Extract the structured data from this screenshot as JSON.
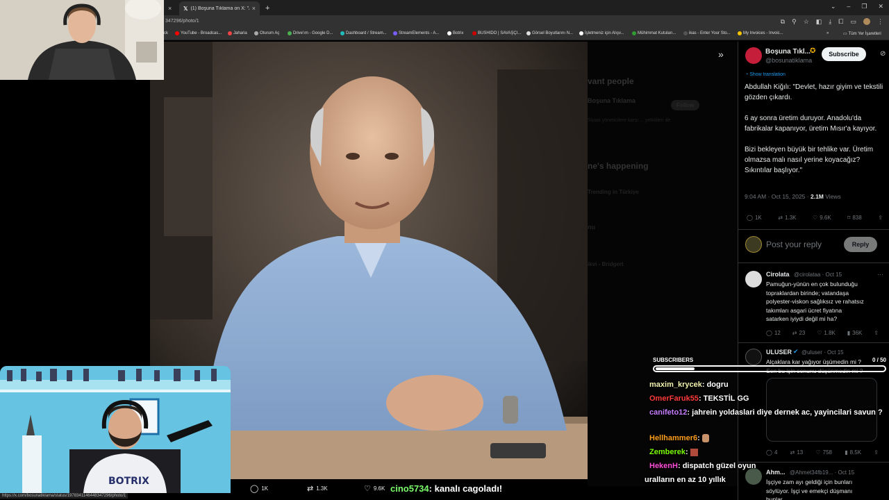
{
  "browser": {
    "tabs": [
      {
        "title": "",
        "close": "×"
      },
      {
        "title": "(1) Boşuna Tıklama on X: \"Abdu",
        "close": "×",
        "active": true
      }
    ],
    "new_tab": "+",
    "url": "347296/photo/1",
    "bookmarks": [
      "ck",
      "YouTube - Broadcas...",
      "Jaharia",
      "Oturum Aç",
      "Drive'ım - Google D...",
      "Dashboard / Stream...",
      "StreamElements - A...",
      "Botrix",
      "BUSHIDO | SAVAŞÇI...",
      "Görsel Boyutlarını N...",
      "İşletmeniz için Alışv...",
      "Mühimmat Kutuları...",
      "ikas - Enter Your Sto...",
      "My Invoices - Invoic..."
    ],
    "bookmarks_more": "»",
    "all_bookmarks": "Tüm Yer İşaretleri",
    "status_url": "https://x.com/bosunatiklama/status/1978341146448347296/photo/1"
  },
  "dim_panel": {
    "items": [
      "vant people",
      "Boşuna Tıklama",
      "Follow",
      "Siyasi yöneticilere karşı ... yetkilileri de",
      "ne's happening",
      "Trending in Türkiye",
      "nu",
      "ikvi - Bridgert"
    ]
  },
  "tweet": {
    "author_name": "Boşuna Tıkl...",
    "author_handle": "@bosunatiklama",
    "subscribe_label": "Subscribe",
    "show_translation": "Show translation",
    "body": "Abdullah Kiğılı: \"Devlet, hazır giyim ve tekstili gözden çıkardı.\n\n6 ay sonra üretim duruyor. Anadolu'da fabrikalar kapanıyor, üretim Mısır'a kayıyor.\n\nBizi bekleyen büyük bir tehlike var. Üretim olmazsa malı nasıl yerine koyacağız? Sıkıntılar başlıyor.\"",
    "time": "9:04 AM · Oct 15, 2025 ·",
    "views": "2.1M",
    "views_label": "Views",
    "stats": {
      "replies": "1K",
      "retweets": "1.3K",
      "likes": "9.6K",
      "bookmarks": "838"
    },
    "reply_placeholder": "Post your reply",
    "reply_button": "Reply",
    "colors": {
      "verified": "#f4b400",
      "blue_check": "#1d9bf0"
    }
  },
  "replies": [
    {
      "name": "Cirolata",
      "handle": "@cirolataa · Oct 15",
      "text": "Pamuğun-yünün en çok bulunduğu\ntopraklardan birinde; vatandaşa\npolyester-viskon sağlıksız ve rahatsız\ntakımları asgari ücret fiyatına\nsatarken iyiydi değil mi ha?",
      "stats": [
        "12",
        "23",
        "1.8K",
        "36K"
      ]
    },
    {
      "name": "ULUSER",
      "handle": "@uluser · Oct 15",
      "text": "Alçaklara kar yağıyor üşümedin mi ?\nSen bu işin sonunu düşünmedin mi ?",
      "stats": [
        "4",
        "13",
        "758",
        "8.5K"
      ]
    },
    {
      "name": "Ahm...",
      "handle": "@Ahmet34fb19... · Oct 15",
      "text": "İşçiye zam ayı geldiği için bunları\nsöylüyor. İşçi ve emekçi düşmanı\nbunlar.",
      "stats": []
    }
  ],
  "chat": {
    "subscribers_label": "SUBSCRIBERS",
    "subscribers_count": "0 / 50",
    "subscribers_progress": 0.17,
    "messages": [
      {
        "user": "maxim_krycek",
        "color": "#f2f2b0",
        "text": ": dogru"
      },
      {
        "user": "OmerFaruk55",
        "color": "#ff3b3b",
        "text": ": TEKSTİL GG"
      },
      {
        "user": "canifeto12",
        "color": "#c77dff",
        "text": ": jahrein yoldaslari diye dernek ac, yayincilari savun ?"
      },
      {
        "user": "Hellhammer6",
        "color": "#ff9f1c",
        "text": ":"
      },
      {
        "user": "Zemberek",
        "color": "#7cfc00",
        "text": ":"
      },
      {
        "user": "HekenH",
        "color": "#ff4fd8",
        "text": ": dispatch güzel oyun"
      },
      {
        "user": "",
        "color": "#ffffff",
        "text": "uralların en az 10 yıllık"
      }
    ]
  },
  "photo_bar": {
    "replies": "1K",
    "retweets": "1.3K",
    "likes": "9.6K"
  },
  "alert": {
    "user": "cino5734",
    "text": ": kanalı cagoladı!"
  }
}
